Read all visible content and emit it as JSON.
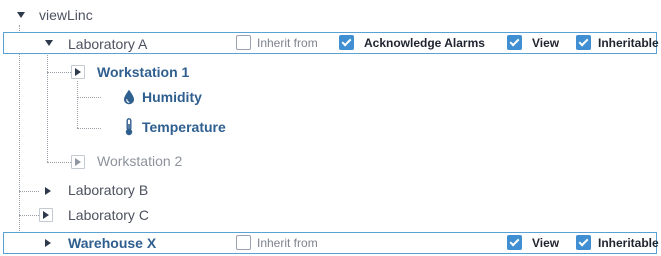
{
  "tree": {
    "root": {
      "label": "viewLinc",
      "expanded": true
    },
    "laboratory_a": {
      "label": "Laboratory A",
      "expanded": true,
      "permissions": [
        {
          "label": "Inherit from",
          "checked": false
        },
        {
          "label": "Acknowledge Alarms",
          "checked": true
        },
        {
          "label": "View",
          "checked": true
        },
        {
          "label": "Inheritable",
          "checked": true
        }
      ],
      "children": {
        "workstation_1": {
          "label": "Workstation 1",
          "expanded": true,
          "children": [
            {
              "label": "Humidity",
              "icon": "droplet-icon"
            },
            {
              "label": "Temperature",
              "icon": "thermometer-icon"
            }
          ]
        },
        "workstation_2": {
          "label": "Workstation 2",
          "expanded": false
        }
      }
    },
    "laboratory_b": {
      "label": "Laboratory B",
      "expanded": false
    },
    "laboratory_c": {
      "label": "Laboratory C",
      "expanded": false
    },
    "warehouse_x": {
      "label": "Warehouse X",
      "expanded": false,
      "permissions": [
        {
          "label": "Inherit from",
          "checked": false
        },
        {
          "label": "View",
          "checked": true
        },
        {
          "label": "Inheritable",
          "checked": true
        }
      ]
    }
  },
  "colors": {
    "selected_border": "#5aa2d4",
    "checkbox_on": "#3f8fd2",
    "location_label": "#2f5f8f",
    "connector": "#9aa0a8"
  }
}
